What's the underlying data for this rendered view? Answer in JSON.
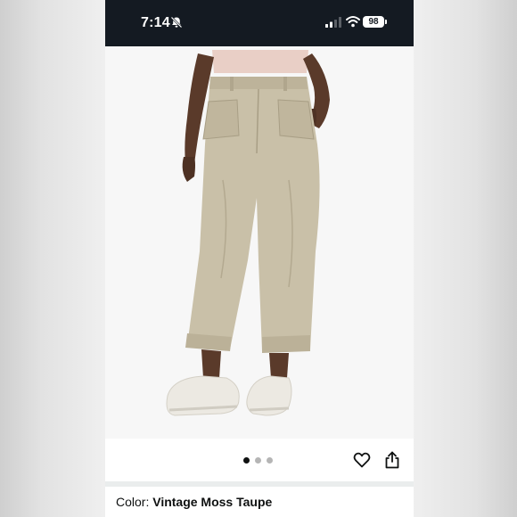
{
  "status_bar": {
    "time": "7:14",
    "battery": "98",
    "icons": [
      "silent-bell-icon",
      "cellular-signal-icon",
      "wifi-icon",
      "battery-icon"
    ]
  },
  "product": {
    "image": "product-photo",
    "carousel": {
      "total_images": 3,
      "active_index": 0
    },
    "actions": [
      "heart-icon",
      "share-icon"
    ]
  },
  "variation": {
    "label": "Color:",
    "value": "Vintage Moss Taupe"
  },
  "colors": {
    "status_bar_bg": "#141a22",
    "pants": "#c9c0a8",
    "active_dot": "#0f1111",
    "inactive_dot": "#b5b5b5"
  }
}
